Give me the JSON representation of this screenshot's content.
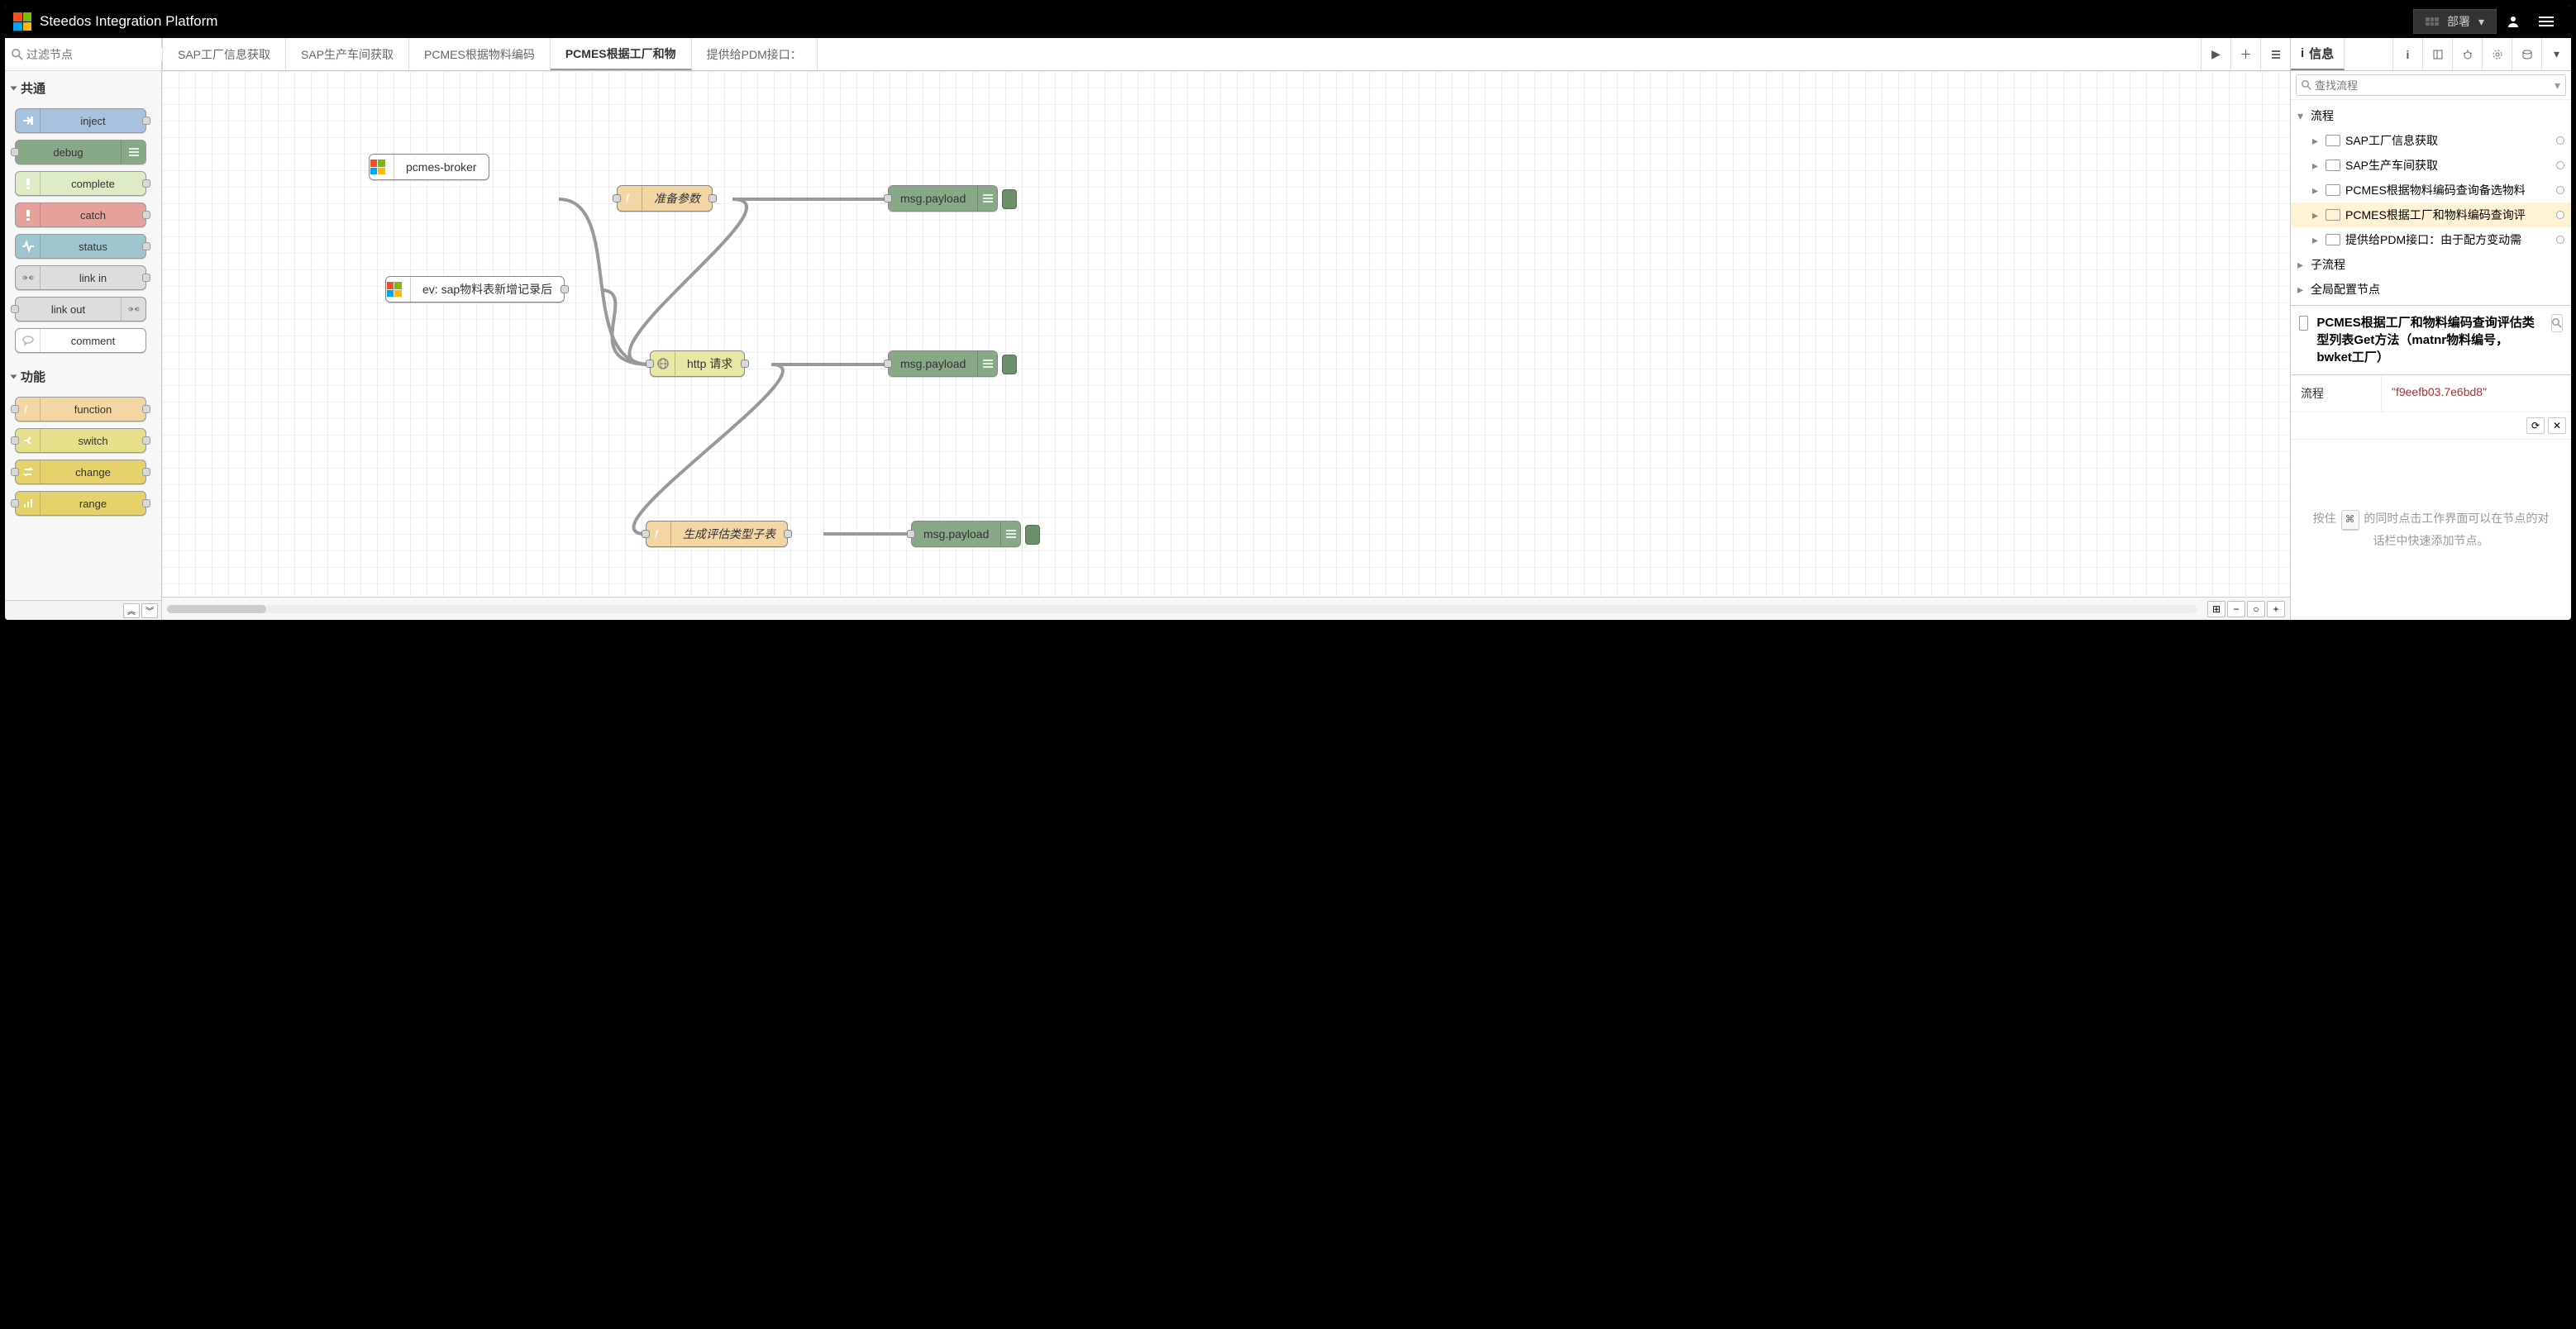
{
  "header": {
    "title": "Steedos Integration Platform",
    "deploy_label": "部署"
  },
  "palette": {
    "filter_placeholder": "过滤节点",
    "categories": [
      {
        "name": "共通",
        "nodes": [
          {
            "key": "inject",
            "label": "inject",
            "color": "c-inject",
            "icon": "arrow-in",
            "iconSide": "left",
            "ports": "r"
          },
          {
            "key": "debug",
            "label": "debug",
            "color": "c-debug",
            "icon": "lines",
            "iconSide": "right",
            "ports": "l"
          },
          {
            "key": "complete",
            "label": "complete",
            "color": "c-complete",
            "icon": "bang",
            "iconSide": "left",
            "ports": "r"
          },
          {
            "key": "catch",
            "label": "catch",
            "color": "c-catch",
            "icon": "bang",
            "iconSide": "left",
            "ports": "r"
          },
          {
            "key": "status",
            "label": "status",
            "color": "c-status",
            "icon": "pulse",
            "iconSide": "left",
            "ports": "r"
          },
          {
            "key": "link-in",
            "label": "link in",
            "color": "c-link",
            "icon": "link",
            "iconSide": "left",
            "ports": "r"
          },
          {
            "key": "link-out",
            "label": "link out",
            "color": "c-link",
            "icon": "link",
            "iconSide": "right",
            "ports": "l"
          },
          {
            "key": "comment",
            "label": "comment",
            "color": "c-comment",
            "icon": "bubble",
            "iconSide": "left",
            "ports": ""
          }
        ]
      },
      {
        "name": "功能",
        "nodes": [
          {
            "key": "function",
            "label": "function",
            "color": "c-function",
            "icon": "fx",
            "iconSide": "left",
            "ports": "lr"
          },
          {
            "key": "switch",
            "label": "switch",
            "color": "c-switch",
            "icon": "split",
            "iconSide": "left",
            "ports": "lr"
          },
          {
            "key": "change",
            "label": "change",
            "color": "c-change",
            "icon": "swap",
            "iconSide": "left",
            "ports": "lr"
          },
          {
            "key": "range",
            "label": "range",
            "color": "c-range",
            "icon": "bars",
            "iconSide": "left",
            "ports": "lr"
          }
        ]
      }
    ]
  },
  "tabs": {
    "items": [
      {
        "label": "SAP工厂信息获取",
        "active": false
      },
      {
        "label": "SAP生产车间获取",
        "active": false
      },
      {
        "label": "PCMES根据物料编码",
        "active": false
      },
      {
        "label": "PCMES根据工厂和物",
        "active": true
      },
      {
        "label": "提供给PDM接口：",
        "active": false
      }
    ]
  },
  "flow_nodes": {
    "broker": {
      "label": "pcmes-broker"
    },
    "event": {
      "label": "ev: sap物料表新增记录后"
    },
    "prepare": {
      "label": "准备参数"
    },
    "http": {
      "label": "http 请求"
    },
    "gen": {
      "label": "生成评估类型子表"
    },
    "dbg1": {
      "label": "msg.payload"
    },
    "dbg2": {
      "label": "msg.payload"
    },
    "dbg3": {
      "label": "msg.payload"
    }
  },
  "sidebar": {
    "info_tab": "信息",
    "search_placeholder": "查找流程",
    "tree": {
      "flows_label": "流程",
      "subflows_label": "子流程",
      "globals_label": "全局配置节点",
      "items": [
        {
          "label": "SAP工厂信息获取",
          "selected": false
        },
        {
          "label": "SAP生产车间获取",
          "selected": false
        },
        {
          "label": "PCMES根据物料编码查询备选物料",
          "selected": false
        },
        {
          "label": "PCMES根据工厂和物料编码查询评",
          "selected": true
        },
        {
          "label": "提供给PDM接口：由于配方变动需",
          "selected": false
        }
      ]
    },
    "detail": {
      "title": "PCMES根据工厂和物料编码查询评估类型列表Get方法（matnr物料编号，bwket工厂）",
      "flow_key": "流程",
      "flow_val": "\"f9eefb03.7e6bd8\""
    },
    "hint_prefix": "按住",
    "hint_key": "⌘",
    "hint_suffix": "的同时点击工作界面可以在节点的对话栏中快速添加节点。"
  }
}
